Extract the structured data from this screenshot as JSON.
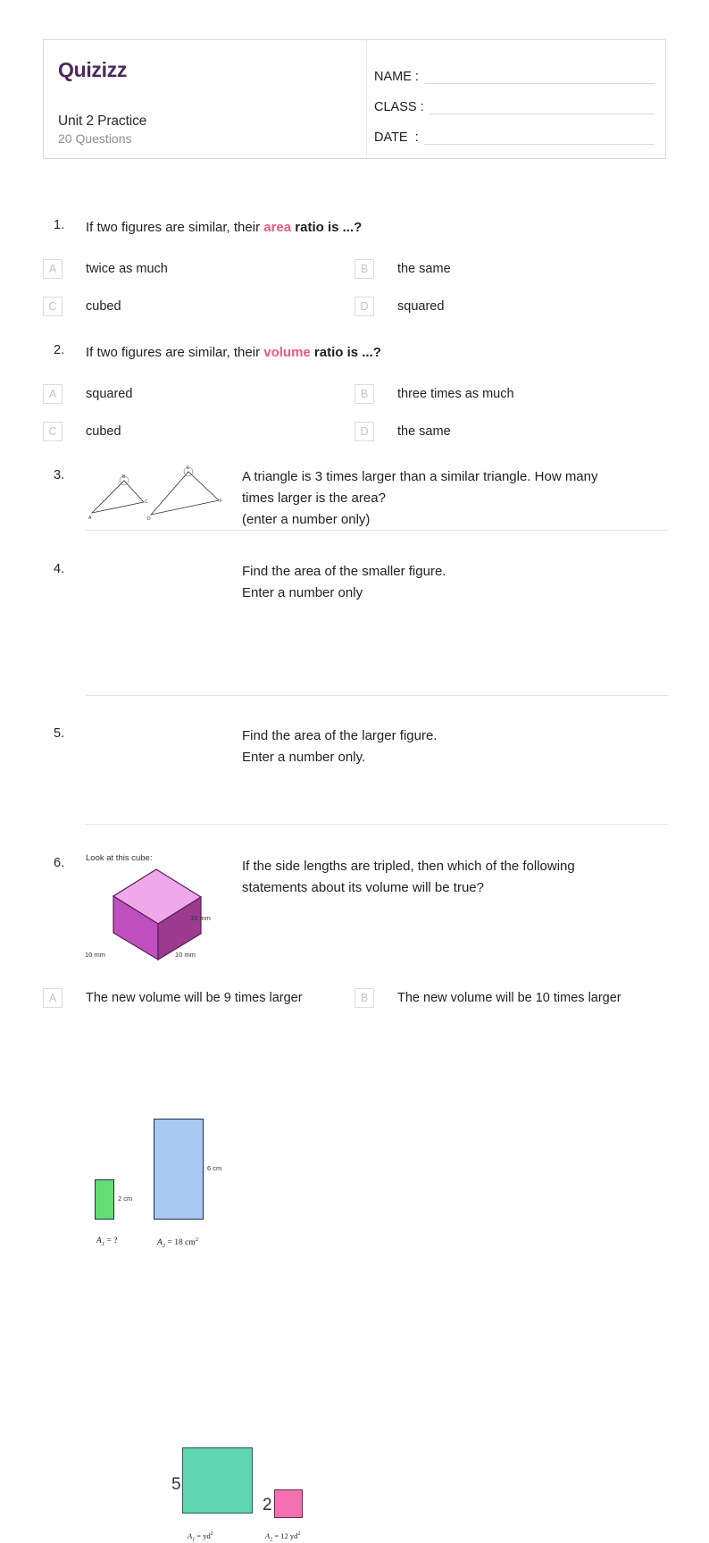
{
  "header": {
    "logo_text": "Quizizz",
    "quiz_title": "Unit 2 Practice",
    "question_count": "20 Questions",
    "fields": [
      {
        "label": "NAME :",
        "value": ""
      },
      {
        "label": "CLASS :",
        "value": ""
      },
      {
        "label": "DATE  :",
        "value": ""
      }
    ]
  },
  "colors": {
    "brand_purple": "#4b2a5e",
    "accent_pink": "#f0587f",
    "green_rect": "#64dd77",
    "blue_rect": "#a9c9f2",
    "teal_square": "#5fd6b0",
    "pink_square": "#f570b0",
    "cube_top": "#efa8ea",
    "cube_left": "#c050c0",
    "cube_right": "#9b3a8e"
  },
  "questions": [
    {
      "number": "1.",
      "text_before": "If two figures are similar, their ",
      "highlight": "area",
      "text_after": " ratio is ...?",
      "options": [
        {
          "letter": "A",
          "text": "twice as much"
        },
        {
          "letter": "B",
          "text": "the same"
        },
        {
          "letter": "C",
          "text": "cubed"
        },
        {
          "letter": "D",
          "text": "squared"
        }
      ]
    },
    {
      "number": "2.",
      "text_before": "If two figures are similar, their ",
      "highlight": "volume",
      "text_after": " ratio is ...?",
      "options": [
        {
          "letter": "A",
          "text": "squared"
        },
        {
          "letter": "B",
          "text": "three times as much"
        },
        {
          "letter": "C",
          "text": "cubed"
        },
        {
          "letter": "D",
          "text": "the same"
        }
      ]
    },
    {
      "number": "3.",
      "line1": "A triangle is 3 times larger than a similar triangle. How many",
      "line2": "times larger is the area?",
      "line3": "(enter a number only)",
      "figure": {
        "type": "two-triangles",
        "labels": [
          "A",
          "B",
          "C",
          "D",
          "E",
          "F"
        ]
      }
    },
    {
      "number": "4.",
      "line1": "Find the area of the smaller figure.",
      "line2": "Enter a number only",
      "figure": {
        "type": "two-rectangles",
        "small_dim": "2 cm",
        "large_dim": "6 cm",
        "area1_label": "A",
        "area1_sub": "1",
        "area1_value": "= ?",
        "area2_label": "A",
        "area2_sub": "2",
        "area2_value": "= 18 cm",
        "area2_sup": "2"
      }
    },
    {
      "number": "5.",
      "line1": "Find the area of the larger figure.",
      "line2": "Enter a number only.",
      "figure": {
        "type": "two-squares",
        "large_dim": "5",
        "small_dim": "2",
        "area1_label": "A",
        "area1_sub": "1",
        "area1_value": "=    yd",
        "area1_sup": "2",
        "area2_label": "A",
        "area2_sub": "2",
        "area2_value": "= 12 yd",
        "area2_sup": "2"
      }
    },
    {
      "number": "6.",
      "caption": "Look at this cube:",
      "line1": "If the side lengths are tripled, then which of the following",
      "line2": "statements about its volume will be true?",
      "figure": {
        "type": "cube",
        "dim_right": "10 mm",
        "dim_left": "10 mm",
        "dim_front": "10 mm"
      },
      "options": [
        {
          "letter": "A",
          "text": "The new volume will be 9 times larger"
        },
        {
          "letter": "B",
          "text": "The new volume will be 10 times larger"
        }
      ]
    }
  ]
}
